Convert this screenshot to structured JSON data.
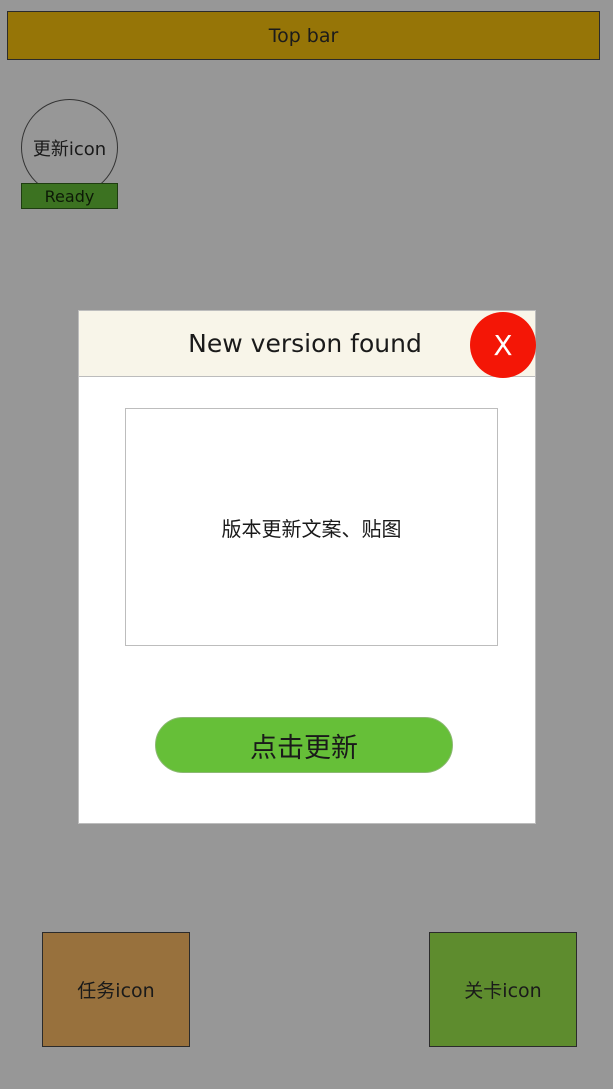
{
  "top_bar": {
    "label": "Top bar"
  },
  "update_icon": {
    "label": "更新icon"
  },
  "status_badge": {
    "label": "Ready"
  },
  "modal": {
    "title": "New version found",
    "close_label": "X",
    "content_text": "版本更新文案、贴图",
    "update_button_label": "点击更新"
  },
  "bottom": {
    "task_icon_label": "任务icon",
    "level_icon_label": "关卡icon"
  },
  "colors": {
    "background": "#979797",
    "top_bar": "#967507",
    "status_badge": "#3c7221",
    "modal_header": "#f8f5e9",
    "close_button": "#f41606",
    "update_button": "#66bf38",
    "task_icon": "#98713d",
    "level_icon": "#5e8c2e"
  }
}
